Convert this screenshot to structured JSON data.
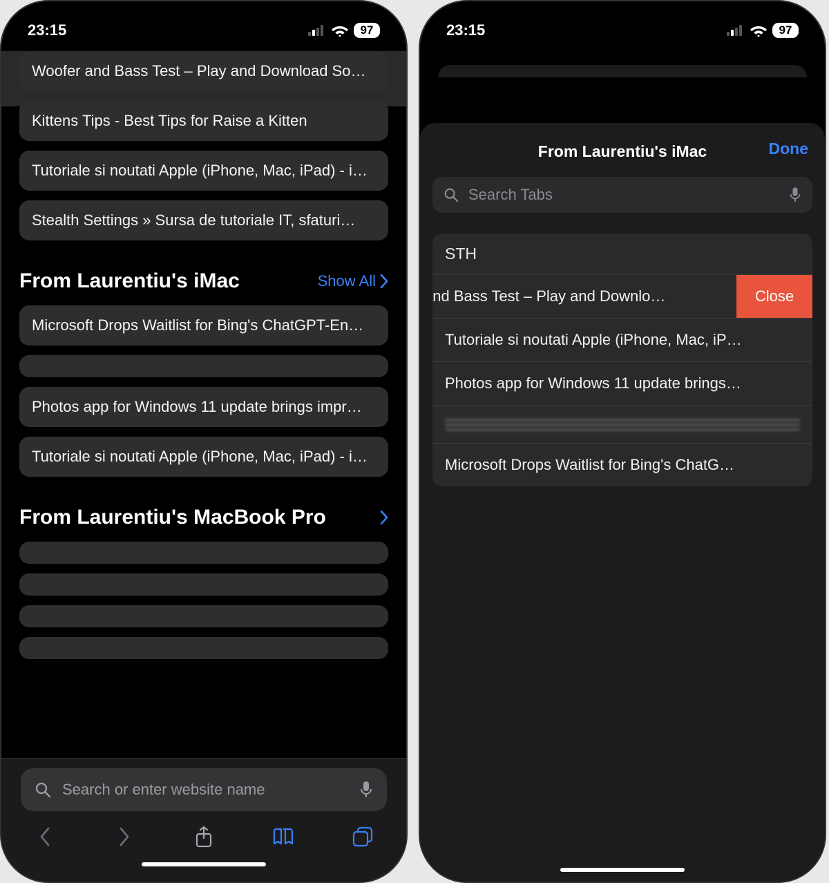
{
  "status": {
    "time": "23:15",
    "battery_percent": "97"
  },
  "left": {
    "top_tabs": [
      "Woofer and Bass Test – Play and Download So…",
      "Kittens Tips - Best Tips for Raise a Kitten",
      "Tutoriale si noutati Apple (iPhone, Mac, iPad) - i…",
      "Stealth Settings » Sursa de tutoriale IT, sfaturi…"
    ],
    "section1": {
      "title": "From Laurentiu's iMac",
      "show_all": "Show All"
    },
    "section1_items": [
      {
        "text": "Microsoft Drops Waitlist for Bing's ChatGPT-En…",
        "blurred": false
      },
      {
        "text": "",
        "blurred": true
      },
      {
        "text": "Photos app for Windows 11 update brings impr…",
        "blurred": false
      },
      {
        "text": "Tutoriale si noutati Apple (iPhone, Mac, iPad) - i…",
        "blurred": false
      }
    ],
    "section2": {
      "title": "From Laurentiu's MacBook Pro"
    },
    "section2_items": [
      {
        "text": "",
        "blurred": true
      },
      {
        "text": "",
        "blurred": true
      },
      {
        "text": "",
        "blurred": true
      },
      {
        "text": "",
        "blurred": true
      }
    ],
    "address_placeholder": "Search or enter website name"
  },
  "right": {
    "sheet_title": "From Laurentiu's iMac",
    "done": "Done",
    "search_placeholder": "Search Tabs",
    "group_label": "STH",
    "close_label": "Close",
    "rows": [
      {
        "text": "and Bass Test – Play and Downlo…",
        "swiped": true,
        "blurred": false
      },
      {
        "text": "Tutoriale si noutati Apple (iPhone, Mac, iP…",
        "swiped": false,
        "blurred": false
      },
      {
        "text": "Photos app for Windows 11 update brings…",
        "swiped": false,
        "blurred": false
      },
      {
        "text": "",
        "swiped": false,
        "blurred": true
      },
      {
        "text": "Microsoft Drops Waitlist for Bing's ChatG…",
        "swiped": false,
        "blurred": false
      }
    ]
  }
}
